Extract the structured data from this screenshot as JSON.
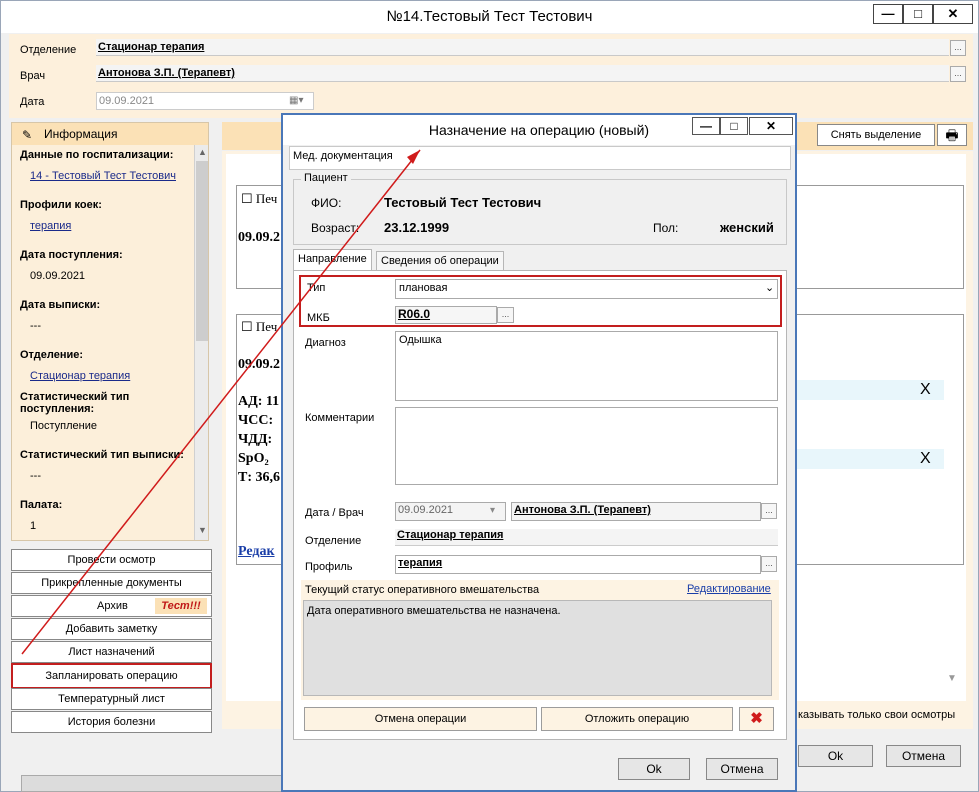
{
  "main_window": {
    "title": "№14.Тестовый Тест Тестович",
    "controls": {
      "minimize": "—",
      "maximize": "□",
      "close": "✕"
    }
  },
  "header": {
    "department_label": "Отделение",
    "department_value": "Стационар  терапия",
    "doctor_label": "Врач",
    "doctor_value": "Антонова  З.П. (Терапевт)",
    "date_label": "Дата",
    "date_value": "09.09.2021"
  },
  "left_panel": {
    "header": "Информация",
    "items": [
      {
        "title": "Данные по госпитализации:",
        "value": "14 - Тестовый Тест Тестович",
        "link": true
      },
      {
        "title": "Профили коек:",
        "value": "терапия",
        "link": true
      },
      {
        "title": "Дата поступления:",
        "value": "09.09.2021",
        "link": false
      },
      {
        "title": "Дата выписки:",
        "value": "---",
        "link": false
      },
      {
        "title": "Отделение:",
        "value": "Стационар  терапия",
        "link": true
      },
      {
        "title": "Статистический тип поступления:",
        "value": "Поступление",
        "link": false
      },
      {
        "title": "Статистический тип выписки:",
        "value": "---",
        "link": false
      },
      {
        "title": "Палата:",
        "value": "1",
        "link": false
      }
    ]
  },
  "side_buttons": [
    "Провести осмотр",
    "Прикрепленные документы",
    "Архив",
    "Добавить заметку",
    "Лист назначений",
    "Запланировать операцию",
    "Температурный лист",
    "История болезни"
  ],
  "archive_badge": "Тест!!!",
  "background": {
    "clear_selection_button": "Снять выделение",
    "card1_check": "Печ",
    "card1_date": "09.09.2",
    "card2_check": "Печ",
    "card2_date": "09.09.2",
    "card2_lines": [
      "АД: 11",
      "ЧСС:",
      "ЧДД:",
      "SpO₂",
      "Т: 36,6"
    ],
    "card2_link": "Редак",
    "x_mark": "X",
    "show_own_label": "казывать только свои осмотры",
    "ok_button": "Ok",
    "cancel_button": "Отмена"
  },
  "dialog": {
    "title": "Назначение на операцию (новый)",
    "section": "Мед. документация",
    "patient_group": "Пациент",
    "fio_label": "ФИО:",
    "fio_value": "Тестовый Тест Тестович",
    "age_label": "Возраст:",
    "age_value": "23.12.1999",
    "sex_label": "Пол:",
    "sex_value": "женский",
    "tabs": [
      "Направление",
      "Сведения об операции"
    ],
    "type_label": "Тип",
    "type_value": "плановая",
    "mkb_label": "МКБ",
    "mkb_value": "R06.0",
    "diagnosis_label": "Диагноз",
    "diagnosis_value": "Одышка",
    "comments_label": "Комментарии",
    "comments_value": "",
    "date_doctor_label": "Дата / Врач",
    "date_value": "09.09.2021",
    "doctor_value": "Антонова  З.П. (Терапевт)",
    "department_label": "Отделение",
    "department_value": "Стационар  терапия",
    "profile_label": "Профиль",
    "profile_value": "терапия",
    "status_label": "Текущий статус оперативного вмешательства",
    "edit_link": "Редактирование",
    "status_text": "Дата оперативного вмешательства не назначена.",
    "cancel_op_button": "Отмена операции",
    "postpone_button": "Отложить операцию",
    "ok_button": "Ok",
    "cancel_button": "Отмена"
  }
}
